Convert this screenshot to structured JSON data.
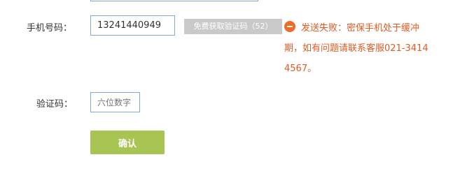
{
  "form": {
    "phone_label": "手机号码：",
    "phone_value": "13241440949",
    "sms_button_label": "免费获取验证码（52）",
    "error_message": "发送失败：密保手机处于缓冲期，如有问题请联系客服021-34144567。",
    "code_label": "验证码：",
    "code_placeholder": "六位数字",
    "confirm_label": "确认"
  },
  "colors": {
    "error": "#e15a22",
    "error_icon": "#f06a2a",
    "confirm_button": "#a8c452",
    "disabled_button": "#c9c9c9",
    "input_border": "#7fa7d8"
  },
  "icons": {
    "error": "minus-circle-icon"
  }
}
